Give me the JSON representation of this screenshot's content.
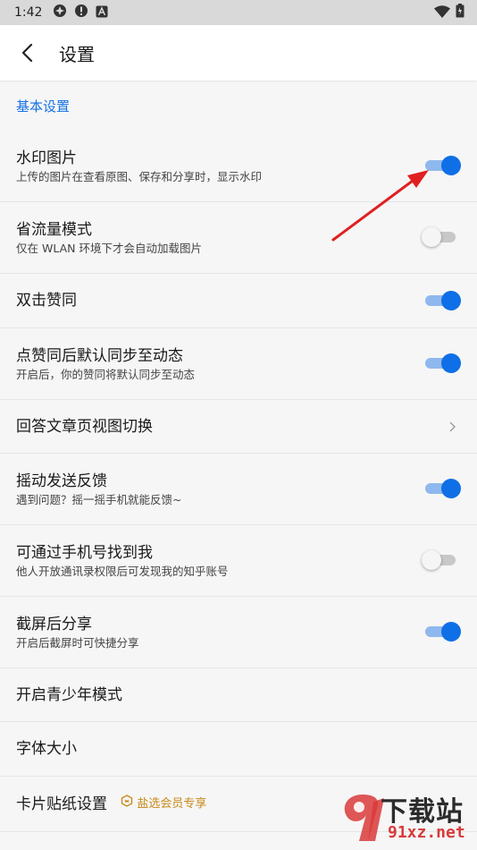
{
  "status_bar": {
    "time": "1:42"
  },
  "app_bar": {
    "title": "设置"
  },
  "section": {
    "title": "基本设置"
  },
  "settings": [
    {
      "label": "水印图片",
      "sub": "上传的图片在查看原图、保存和分享时，显示水印",
      "toggle": true
    },
    {
      "label": "省流量模式",
      "sub": "仅在 WLAN 环境下才会自动加载图片",
      "toggle": false
    },
    {
      "label": "双击赞同",
      "toggle": true
    },
    {
      "label": "点赞同后默认同步至动态",
      "sub": "开启后，你的赞同将默认同步至动态",
      "toggle": true
    },
    {
      "label": "回答文章页视图切换"
    },
    {
      "label": "摇动发送反馈",
      "sub": "遇到问题？摇一摇手机就能反馈~",
      "toggle": true
    },
    {
      "label": "可通过手机号找到我",
      "sub": "他人开放通讯录权限后可发现我的知乎账号",
      "toggle": false
    },
    {
      "label": "截屏后分享",
      "sub": "开启后截屏时可快捷分享",
      "toggle": true
    },
    {
      "label": "开启青少年模式"
    },
    {
      "label": "字体大小"
    },
    {
      "label": "卡片贴纸设置",
      "badge": "盐选会员专享"
    }
  ],
  "watermark": {
    "brand": "下载站",
    "url": "91xz.net"
  },
  "colors": {
    "accent": "#1772e6",
    "toggle_on": "#0f6fe6",
    "annotation_arrow": "#e02020"
  }
}
